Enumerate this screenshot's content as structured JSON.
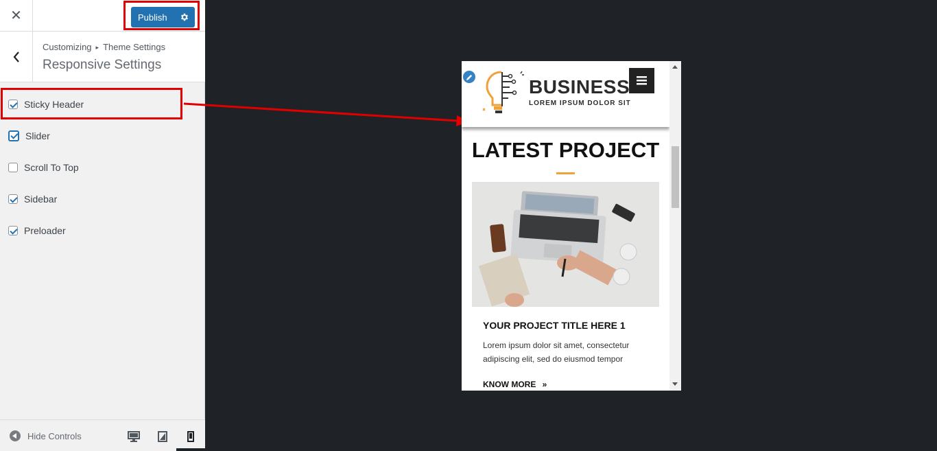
{
  "topbar": {
    "close_icon": "close-icon",
    "publish_label": "Publish",
    "settings_icon": "gear-icon"
  },
  "section": {
    "breadcrumb_parent": "Customizing",
    "breadcrumb_child": "Theme Settings",
    "title": "Responsive Settings"
  },
  "options": [
    {
      "label": "Sticky Header",
      "checked": true
    },
    {
      "label": "Slider",
      "checked": true
    },
    {
      "label": "Scroll To Top",
      "checked": false
    },
    {
      "label": "Sidebar",
      "checked": true
    },
    {
      "label": "Preloader",
      "checked": true
    }
  ],
  "footer": {
    "hide_controls_label": "Hide Controls",
    "devices": [
      "desktop",
      "tablet",
      "mobile"
    ],
    "active_device": "mobile"
  },
  "preview": {
    "brand": "BUSINESS",
    "tagline": "LOREM IPSUM DOLOR SIT",
    "section_title": "LATEST PROJECT",
    "project_title": "YOUR PROJECT TITLE HERE 1",
    "project_desc": "Lorem ipsum dolor sit amet, consectetur adipiscing elit, sed do eiusmod tempor",
    "know_more": "KNOW MORE",
    "accent_color": "#f0a13c"
  },
  "colors": {
    "primary": "#2271b1",
    "highlight": "#e00000",
    "canvas_bg": "#1f2226"
  }
}
